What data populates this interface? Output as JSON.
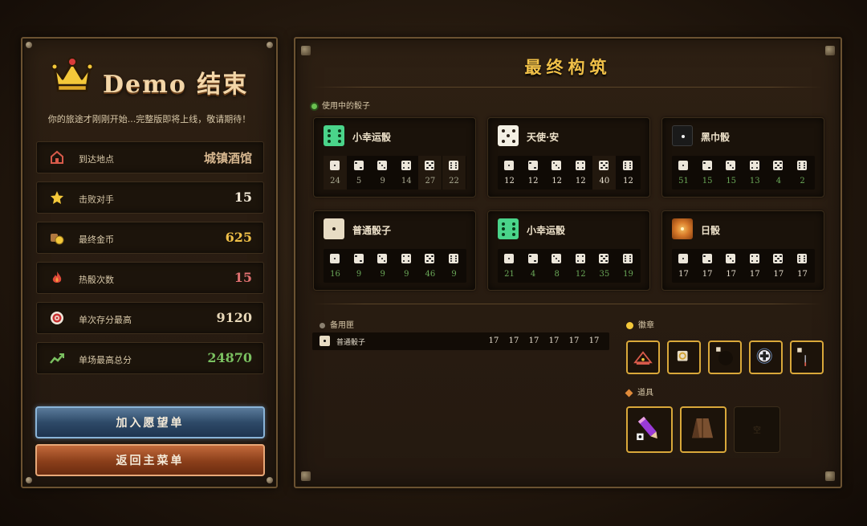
{
  "demo": {
    "title": "Demo 结束",
    "subtitle": "你的旅途才刚刚开始...完整版即将上线，敬请期待！"
  },
  "stats": [
    {
      "icon": "house-icon",
      "label": "到达地点",
      "value": "城镇酒馆",
      "color": "#d8b890"
    },
    {
      "icon": "star-icon",
      "label": "击败对手",
      "value": "15",
      "color": "#f4ead8"
    },
    {
      "icon": "coin-bag-icon",
      "label": "最终金币",
      "value": "625",
      "color": "#f0c048"
    },
    {
      "icon": "flame-icon",
      "label": "热骰次数",
      "value": "15",
      "color": "#e07070"
    },
    {
      "icon": "target-icon",
      "label": "单次存分最高",
      "value": "9120",
      "color": "#e8d8b8"
    },
    {
      "icon": "trend-up-icon",
      "label": "单场最高总分",
      "value": "24870",
      "color": "#7ac060"
    }
  ],
  "buttons": {
    "wishlist": "加入愿望单",
    "main_menu": "返回主菜单"
  },
  "build": {
    "title": "最终构筑",
    "in_use_label": "使用中的骰子",
    "dice": [
      {
        "name": "小幸运骰",
        "icon": "lucky-die-icon",
        "icon_color": "#4ad48a",
        "values": [
          "24",
          "5",
          "9",
          "14",
          "27",
          "22"
        ],
        "value_color": "#a8a890",
        "highlight": [
          0,
          4,
          5
        ]
      },
      {
        "name": "天使·安",
        "icon": "angel-die-icon",
        "icon_color": "#f4f0e4",
        "values": [
          "12",
          "12",
          "12",
          "12",
          "40",
          "12"
        ],
        "value_color": "#e8e0d0",
        "highlight": [
          4
        ]
      },
      {
        "name": "黑巾骰",
        "icon": "black-die-icon",
        "icon_color": "#1a1a1a",
        "values": [
          "51",
          "15",
          "15",
          "13",
          "4",
          "2"
        ],
        "value_color": "#6aa858",
        "highlight": []
      },
      {
        "name": "普通骰子",
        "icon": "normal-die-icon",
        "icon_color": "#e8dcc4",
        "values": [
          "16",
          "9",
          "9",
          "9",
          "46",
          "9"
        ],
        "value_color": "#6aa858",
        "highlight": []
      },
      {
        "name": "小幸运骰",
        "icon": "lucky-die-icon",
        "icon_color": "#4ad48a",
        "values": [
          "21",
          "4",
          "8",
          "12",
          "35",
          "19"
        ],
        "value_color": "#6aa858",
        "highlight": []
      },
      {
        "name": "日骰",
        "icon": "sun-die-icon",
        "icon_color": "#d87a2a",
        "values": [
          "17",
          "17",
          "17",
          "17",
          "17",
          "17"
        ],
        "value_color": "#e8e0d0",
        "highlight": []
      }
    ],
    "reserve_label": "备用匣",
    "reserve": [
      {
        "name": "普通骰子",
        "values": [
          "17",
          "17",
          "17",
          "17",
          "17",
          "17"
        ]
      }
    ],
    "badges_label": "徽章",
    "badges": [
      "tavern-badge-icon",
      "ring-badge-icon",
      "dot-badge-icon",
      "cross-badge-icon",
      "sword-badge-icon"
    ],
    "items_label": "道具",
    "items": [
      "pencil-item-icon",
      "wood-plank-item-icon",
      "empty-slot-icon"
    ],
    "empty_slot_mark": "空"
  }
}
